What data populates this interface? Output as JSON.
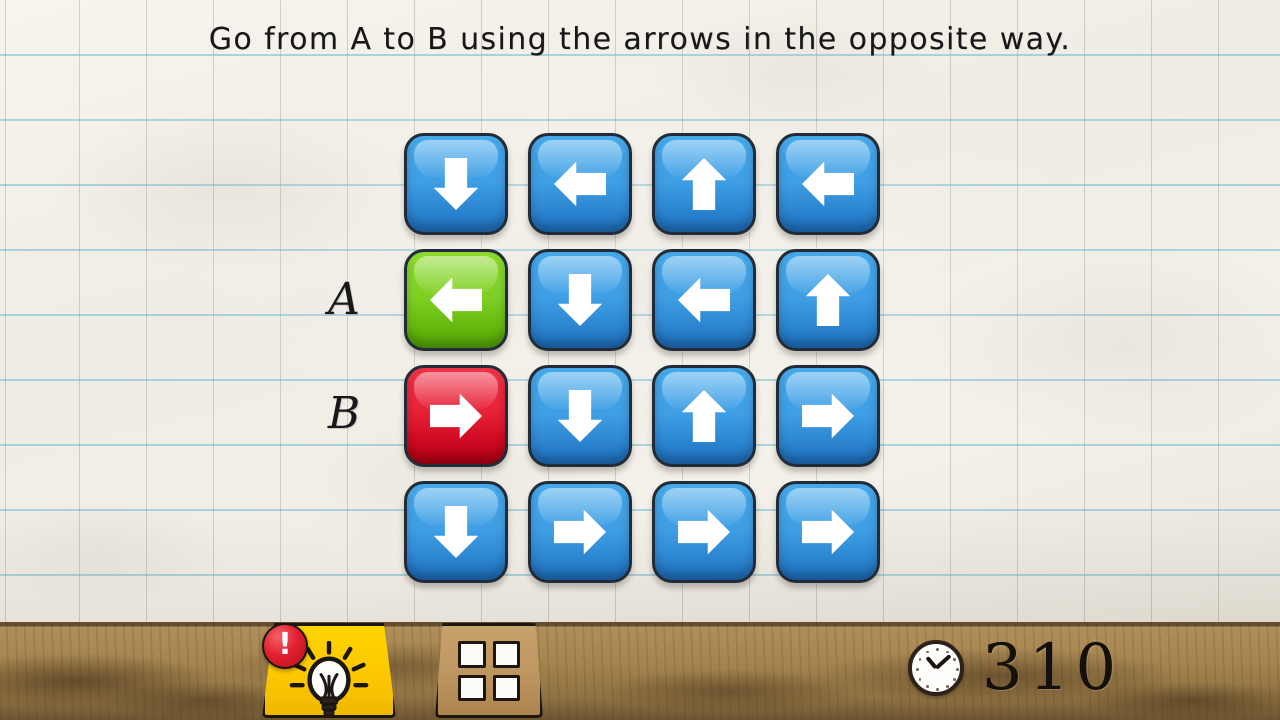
{
  "header": {
    "instruction": "Go from A to B using the arrows in the opposite way."
  },
  "board": {
    "start_label": "A",
    "end_label": "B",
    "rows": 4,
    "cols": 4,
    "tiles": [
      {
        "direction": "down",
        "glyph": "↓",
        "color": "blue",
        "hex": "#3F9EE4",
        "row": 1,
        "col": 1
      },
      {
        "direction": "left",
        "glyph": "←",
        "color": "blue",
        "hex": "#3F9EE4",
        "row": 1,
        "col": 2
      },
      {
        "direction": "up",
        "glyph": "↑",
        "color": "blue",
        "hex": "#3F9EE4",
        "row": 1,
        "col": 3
      },
      {
        "direction": "left",
        "glyph": "←",
        "color": "blue",
        "hex": "#3F9EE4",
        "row": 1,
        "col": 4
      },
      {
        "direction": "left",
        "glyph": "←",
        "color": "green",
        "hex": "#7ECF23",
        "row": 2,
        "col": 1
      },
      {
        "direction": "down",
        "glyph": "↓",
        "color": "blue",
        "hex": "#3F9EE4",
        "row": 2,
        "col": 2
      },
      {
        "direction": "left",
        "glyph": "←",
        "color": "blue",
        "hex": "#3F9EE4",
        "row": 2,
        "col": 3
      },
      {
        "direction": "up",
        "glyph": "↑",
        "color": "blue",
        "hex": "#3F9EE4",
        "row": 2,
        "col": 4
      },
      {
        "direction": "right",
        "glyph": "→",
        "color": "red",
        "hex": "#E61F36",
        "row": 3,
        "col": 1
      },
      {
        "direction": "down",
        "glyph": "↓",
        "color": "blue",
        "hex": "#3F9EE4",
        "row": 3,
        "col": 2
      },
      {
        "direction": "up",
        "glyph": "↑",
        "color": "blue",
        "hex": "#3F9EE4",
        "row": 3,
        "col": 3
      },
      {
        "direction": "right",
        "glyph": "→",
        "color": "blue",
        "hex": "#3F9EE4",
        "row": 3,
        "col": 4
      },
      {
        "direction": "down",
        "glyph": "↓",
        "color": "blue",
        "hex": "#3F9EE4",
        "row": 4,
        "col": 1
      },
      {
        "direction": "right",
        "glyph": "→",
        "color": "blue",
        "hex": "#3F9EE4",
        "row": 4,
        "col": 2
      },
      {
        "direction": "right",
        "glyph": "→",
        "color": "blue",
        "hex": "#3F9EE4",
        "row": 4,
        "col": 3
      },
      {
        "direction": "right",
        "glyph": "→",
        "color": "blue",
        "hex": "#3F9EE4",
        "row": 4,
        "col": 4
      }
    ]
  },
  "toolbar": {
    "hint_icon": "lightbulb-icon",
    "hint_badge": "!",
    "levels_icon": "grid-icon"
  },
  "status": {
    "timer_icon": "clock-icon",
    "timer_value": "310"
  },
  "colors": {
    "tile_blue": "#3F9EE4",
    "tile_green": "#7ECF23",
    "tile_red": "#E61F36",
    "tile_outline": "#222B38",
    "paper": "#F3F0E9",
    "rule_line": "#6EB9D2",
    "desk": "#A5854F",
    "hint_yellow": "#FDC800",
    "badge_red": "#E32030"
  }
}
